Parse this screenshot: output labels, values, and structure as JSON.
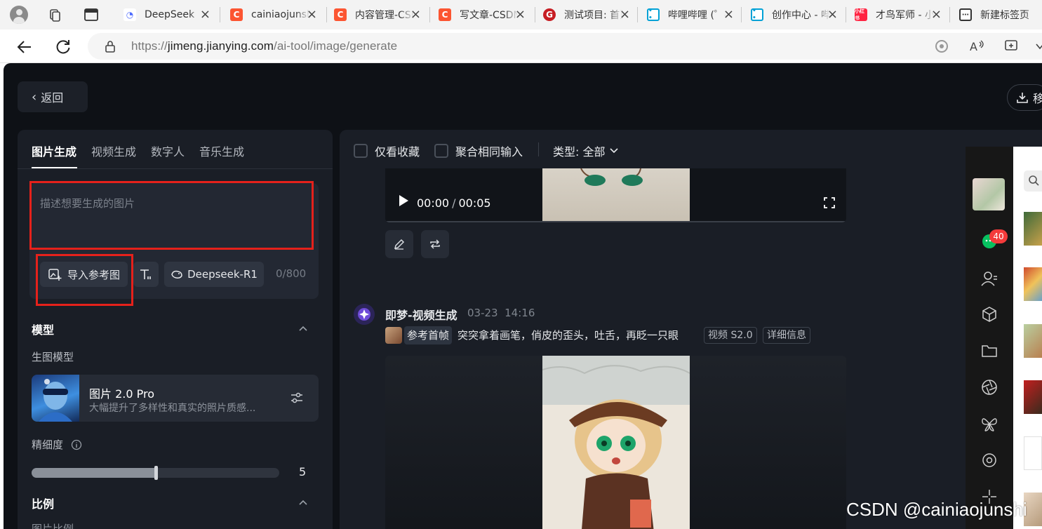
{
  "browser": {
    "tabs": [
      {
        "title": "DeepSeek",
        "icon": "deepseek-whale-icon",
        "color": "#4d6bfe"
      },
      {
        "title": "cainiaojunshi",
        "icon": "csdn-c-icon",
        "color": "#fc5531"
      },
      {
        "title": "内容管理-CSDN",
        "icon": "csdn-c-icon",
        "color": "#fc5531"
      },
      {
        "title": "写文章-CSDN",
        "icon": "csdn-c-icon",
        "color": "#fc5531"
      },
      {
        "title": "测试项目: 首页",
        "icon": "gitee-g-icon",
        "color": "#c71d23"
      },
      {
        "title": "哔哩哔哩 (゜-゜)",
        "icon": "bilibili-icon",
        "color": "#00a1d6"
      },
      {
        "title": "创作中心 - 哔哩",
        "icon": "bilibili-icon",
        "color": "#00a1d6"
      },
      {
        "title": "才鸟军师 - 小红书",
        "icon": "xiaohongshu-icon",
        "color": "#ff2442"
      },
      {
        "title": "新建标签页",
        "icon": "new-tab-icon",
        "color": "#333333"
      }
    ],
    "url_prefix": "https://",
    "url_host": "jimeng.jianying.com",
    "url_path": "/ai-tool/image/generate"
  },
  "app": {
    "back_label": "返回",
    "download_label": "移",
    "left_tabs": [
      "图片生成",
      "视频生成",
      "数字人",
      "音乐生成"
    ],
    "prompt_placeholder": "描述想要生成的图片",
    "import_ref_label": "导入参考图",
    "model_pill_label": "Deepseek-R1",
    "counter": "0/800",
    "model_section": "模型",
    "model_sub": "生图模型",
    "model_name": "图片 2.0 Pro",
    "model_desc": "大幅提升了多样性和真实的照片质感...",
    "precision_label": "精细度",
    "precision_value": "5",
    "precision_fraction": 0.5,
    "ratio_section": "比例",
    "ratio_sub": "图片比例"
  },
  "feed": {
    "filter_favorites": "仅看收藏",
    "filter_merge": "聚合相同输入",
    "type_label": "类型: 全部",
    "video1_current": "00:00",
    "video1_separator": "/",
    "video1_total": "00:05",
    "gen_title": "即梦-视频生成",
    "gen_date": "03-23",
    "gen_time": "14:16",
    "ref_label": "参考首帧",
    "gen_prompt": "突突拿着画笔，俏皮的歪头，吐舌，再眨一只眼",
    "tag_model": "视频 S2.0",
    "tag_detail": "详细信息"
  },
  "dock": {
    "badge_count": "40"
  },
  "watermark": "CSDN @cainiaojunshi"
}
